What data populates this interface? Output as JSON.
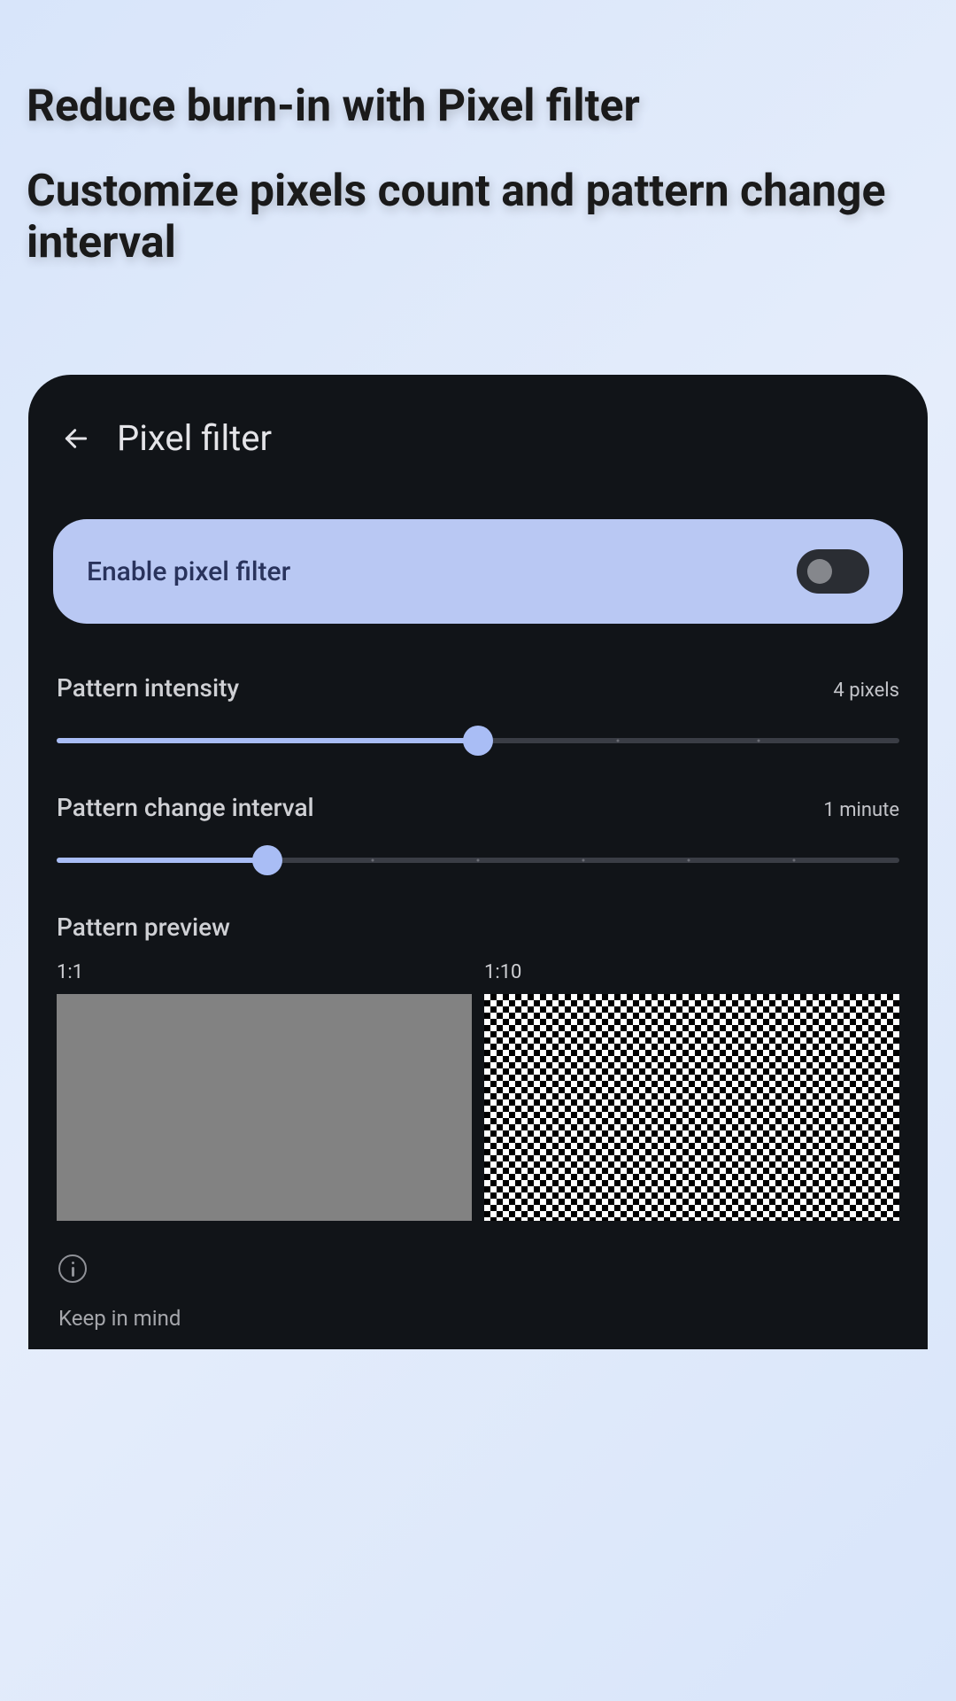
{
  "promo": {
    "title": "Reduce burn-in with Pixel filter",
    "subtitle": "Customize pixels count and pattern change interval"
  },
  "header": {
    "title": "Pixel filter"
  },
  "enable": {
    "label": "Enable pixel filter",
    "state": false
  },
  "sliders": {
    "intensity": {
      "label": "Pattern intensity",
      "value_text": "4 pixels",
      "fill_percent": 50
    },
    "interval": {
      "label": "Pattern change interval",
      "value_text": "1 minute",
      "fill_percent": 25
    }
  },
  "preview": {
    "title": "Pattern preview",
    "ratio_fine": "1:1",
    "ratio_coarse": "1:10"
  },
  "info": {
    "heading": "Keep in mind"
  }
}
